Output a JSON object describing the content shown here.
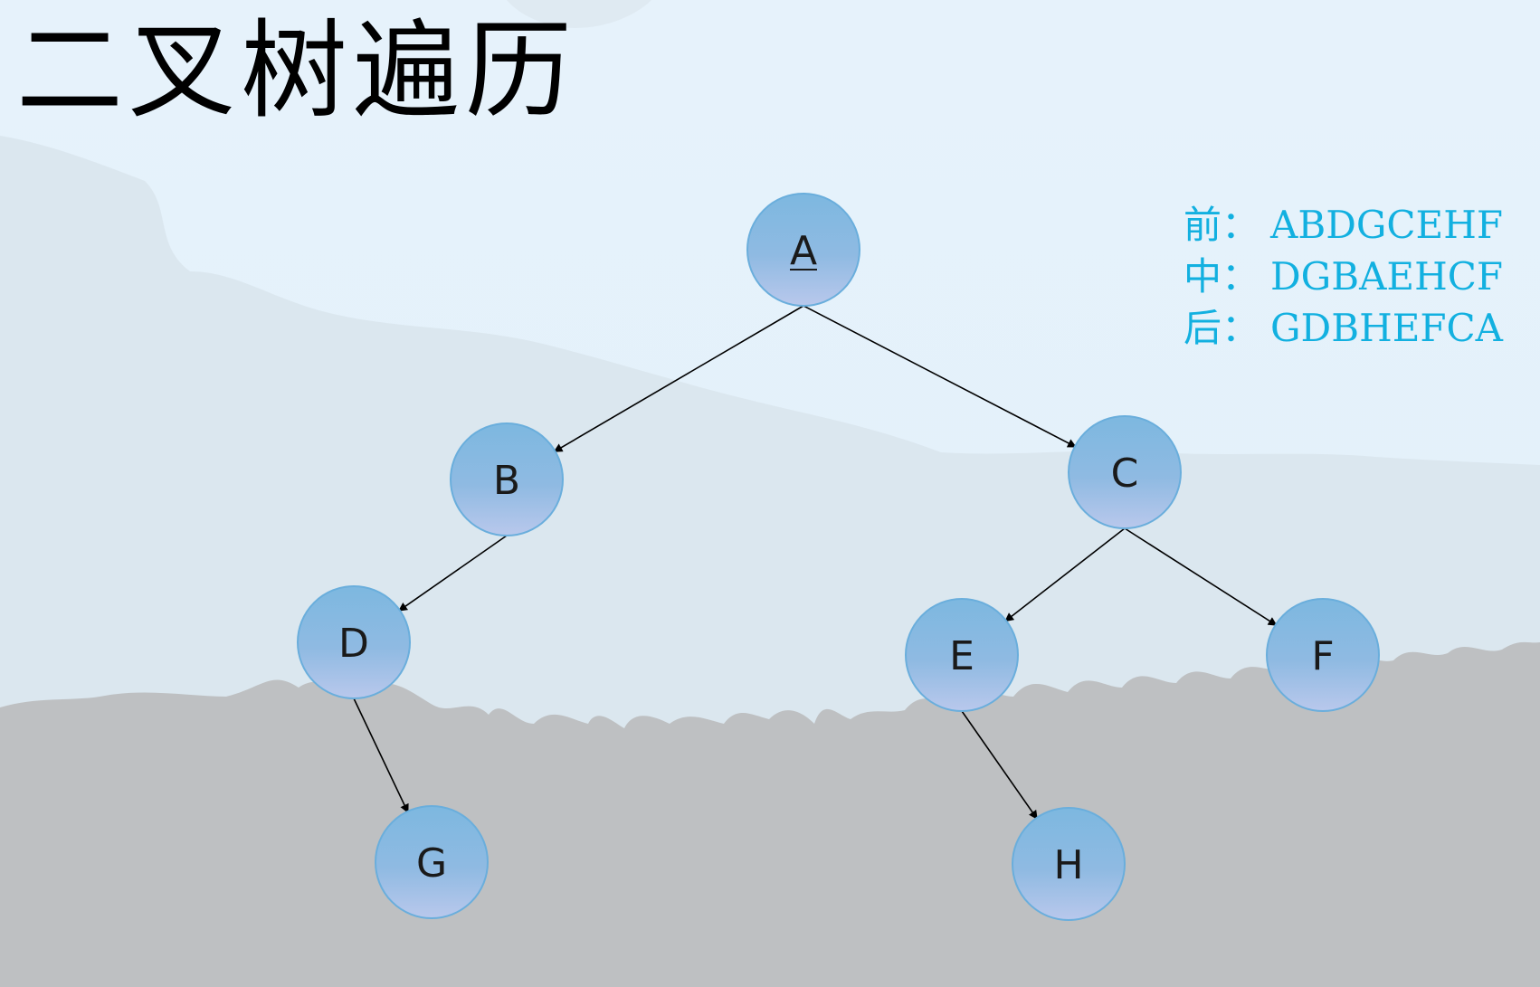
{
  "title": "二叉树遍历",
  "traversals": [
    {
      "label": "前：",
      "sequence": "ABDGCEHF"
    },
    {
      "label": "中：",
      "sequence": "DGBAEHCF"
    },
    {
      "label": "后：",
      "sequence": "GDBHEFCA"
    }
  ],
  "tree": {
    "nodes": [
      "A",
      "B",
      "C",
      "D",
      "E",
      "F",
      "G",
      "H"
    ],
    "edges": [
      {
        "from": "A",
        "to": "B"
      },
      {
        "from": "A",
        "to": "C"
      },
      {
        "from": "B",
        "to": "D"
      },
      {
        "from": "D",
        "to": "G"
      },
      {
        "from": "C",
        "to": "E"
      },
      {
        "from": "C",
        "to": "F"
      },
      {
        "from": "E",
        "to": "H"
      }
    ]
  },
  "colors": {
    "traversal_text": "#12b0e0",
    "node_fill_top": "#7db8e0",
    "node_fill_bottom": "#b6c6ea",
    "node_stroke": "#6aaedc",
    "edge": "#000000"
  }
}
